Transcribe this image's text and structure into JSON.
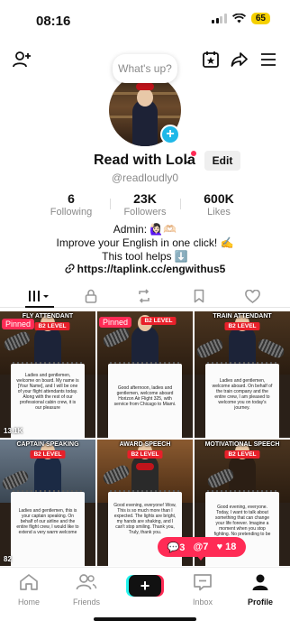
{
  "status_bar": {
    "time": "08:16",
    "battery": "65"
  },
  "composer": {
    "placeholder": "What's up?"
  },
  "profile": {
    "name": "Read with Lola",
    "handle": "@readloudly0",
    "edit_label": "Edit",
    "stats": [
      {
        "value": "6",
        "label": "Following"
      },
      {
        "value": "23K",
        "label": "Followers"
      },
      {
        "value": "600K",
        "label": "Likes"
      }
    ],
    "bio_lines": [
      "Admin: 🙋🏻‍♀️🫶🏻",
      "Improve your English in one click! ✍️",
      "This tool helps ⬇️"
    ],
    "link": "https://taplink.cc/engwithus5"
  },
  "videos": [
    {
      "title": "FLY ATTENDANT",
      "level": "B2 LEVEL",
      "pinned": "Pinned",
      "views": "13.1K",
      "text": "Ladies and gentlemen, welcome on board. My name is [Your Name], and I will be one of your flight attendants today. Along with the rest of our professional cabin crew, it is our pleasure"
    },
    {
      "title": "",
      "level": "B2 LEVEL",
      "pinned": "Pinned",
      "views": "",
      "text": "Good afternoon, ladies and gentlemen, welcome aboard Horizon Air Flight 325, with service from Chicago to Miami."
    },
    {
      "title": "TRAIN ATTENDANT",
      "level": "B2 LEVEL",
      "pinned": "",
      "views": "",
      "text": "Ladies and gentlemen, welcome aboard. On behalf of the train company and the entire crew, I am pleased to welcome you on today's journey."
    },
    {
      "title": "CAPTAIN SPEAKING",
      "level": "B2 LEVEL",
      "pinned": "",
      "views": "82",
      "text": "Ladies and gentlemen, this is your captain speaking. On behalf of our airline and the entire flight crew, I would like to extend a very warm welcome"
    },
    {
      "title": "AWARD SPEECH",
      "level": "B2 LEVEL",
      "pinned": "",
      "views": "",
      "text": "Good evening, everyone! Wow, This is so much more than I expected. The lights are bright, my hands are shaking, and I can't stop smiling. Thank you, Truly, thank you."
    },
    {
      "title": "MOTIVATIONAL SPEECH",
      "level": "B2 LEVEL",
      "pinned": "",
      "views": "",
      "text": "Good evening, everyone. Today, I want to talk about something that can change your life forever. Imagine a moment when you stop fighting. No pretending to be"
    }
  ],
  "notifications": {
    "comments": "3",
    "mentions": "7",
    "likes": "18"
  },
  "nav": {
    "home": "Home",
    "friends": "Friends",
    "create": "+",
    "inbox": "Inbox",
    "profile": "Profile"
  },
  "colors": {
    "accent": "#ff2b55",
    "badge_blue": "#20b8e8",
    "battery": "#f5d000"
  }
}
